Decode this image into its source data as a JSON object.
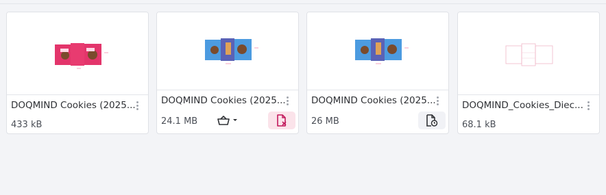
{
  "files": [
    {
      "title": "DOQMIND Cookies (2025...",
      "size": "433 kB"
    },
    {
      "title": "DOQMIND Cookies (2025...",
      "size": "24.1 MB"
    },
    {
      "title": "DOQMIND Cookies (2025...",
      "size": "26 MB"
    },
    {
      "title": "DOQMIND_Cookies_Diec...",
      "size": "68.1 kB"
    }
  ],
  "colors": {
    "delete_bg": "#fbe3ea",
    "delete_icon": "#c2185b",
    "schedule_bg": "#f1f2f6",
    "pink_box": "#e3356b",
    "blue_box": "#4c9be0"
  },
  "icons": {
    "card2_action": "remove-file-icon",
    "card3_action": "file-clock-icon",
    "card2_basket": "basket-icon"
  }
}
